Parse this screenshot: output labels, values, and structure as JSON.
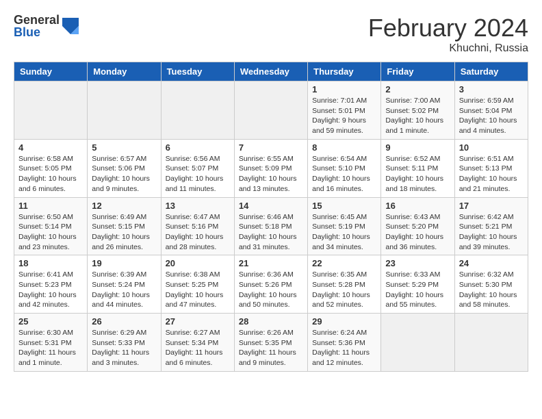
{
  "logo": {
    "general": "General",
    "blue": "Blue"
  },
  "title": "February 2024",
  "location": "Khuchni, Russia",
  "days_of_week": [
    "Sunday",
    "Monday",
    "Tuesday",
    "Wednesday",
    "Thursday",
    "Friday",
    "Saturday"
  ],
  "weeks": [
    [
      {
        "day": "",
        "info": ""
      },
      {
        "day": "",
        "info": ""
      },
      {
        "day": "",
        "info": ""
      },
      {
        "day": "",
        "info": ""
      },
      {
        "day": "1",
        "info": "Sunrise: 7:01 AM\nSunset: 5:01 PM\nDaylight: 9 hours and 59 minutes."
      },
      {
        "day": "2",
        "info": "Sunrise: 7:00 AM\nSunset: 5:02 PM\nDaylight: 10 hours and 1 minute."
      },
      {
        "day": "3",
        "info": "Sunrise: 6:59 AM\nSunset: 5:04 PM\nDaylight: 10 hours and 4 minutes."
      }
    ],
    [
      {
        "day": "4",
        "info": "Sunrise: 6:58 AM\nSunset: 5:05 PM\nDaylight: 10 hours and 6 minutes."
      },
      {
        "day": "5",
        "info": "Sunrise: 6:57 AM\nSunset: 5:06 PM\nDaylight: 10 hours and 9 minutes."
      },
      {
        "day": "6",
        "info": "Sunrise: 6:56 AM\nSunset: 5:07 PM\nDaylight: 10 hours and 11 minutes."
      },
      {
        "day": "7",
        "info": "Sunrise: 6:55 AM\nSunset: 5:09 PM\nDaylight: 10 hours and 13 minutes."
      },
      {
        "day": "8",
        "info": "Sunrise: 6:54 AM\nSunset: 5:10 PM\nDaylight: 10 hours and 16 minutes."
      },
      {
        "day": "9",
        "info": "Sunrise: 6:52 AM\nSunset: 5:11 PM\nDaylight: 10 hours and 18 minutes."
      },
      {
        "day": "10",
        "info": "Sunrise: 6:51 AM\nSunset: 5:13 PM\nDaylight: 10 hours and 21 minutes."
      }
    ],
    [
      {
        "day": "11",
        "info": "Sunrise: 6:50 AM\nSunset: 5:14 PM\nDaylight: 10 hours and 23 minutes."
      },
      {
        "day": "12",
        "info": "Sunrise: 6:49 AM\nSunset: 5:15 PM\nDaylight: 10 hours and 26 minutes."
      },
      {
        "day": "13",
        "info": "Sunrise: 6:47 AM\nSunset: 5:16 PM\nDaylight: 10 hours and 28 minutes."
      },
      {
        "day": "14",
        "info": "Sunrise: 6:46 AM\nSunset: 5:18 PM\nDaylight: 10 hours and 31 minutes."
      },
      {
        "day": "15",
        "info": "Sunrise: 6:45 AM\nSunset: 5:19 PM\nDaylight: 10 hours and 34 minutes."
      },
      {
        "day": "16",
        "info": "Sunrise: 6:43 AM\nSunset: 5:20 PM\nDaylight: 10 hours and 36 minutes."
      },
      {
        "day": "17",
        "info": "Sunrise: 6:42 AM\nSunset: 5:21 PM\nDaylight: 10 hours and 39 minutes."
      }
    ],
    [
      {
        "day": "18",
        "info": "Sunrise: 6:41 AM\nSunset: 5:23 PM\nDaylight: 10 hours and 42 minutes."
      },
      {
        "day": "19",
        "info": "Sunrise: 6:39 AM\nSunset: 5:24 PM\nDaylight: 10 hours and 44 minutes."
      },
      {
        "day": "20",
        "info": "Sunrise: 6:38 AM\nSunset: 5:25 PM\nDaylight: 10 hours and 47 minutes."
      },
      {
        "day": "21",
        "info": "Sunrise: 6:36 AM\nSunset: 5:26 PM\nDaylight: 10 hours and 50 minutes."
      },
      {
        "day": "22",
        "info": "Sunrise: 6:35 AM\nSunset: 5:28 PM\nDaylight: 10 hours and 52 minutes."
      },
      {
        "day": "23",
        "info": "Sunrise: 6:33 AM\nSunset: 5:29 PM\nDaylight: 10 hours and 55 minutes."
      },
      {
        "day": "24",
        "info": "Sunrise: 6:32 AM\nSunset: 5:30 PM\nDaylight: 10 hours and 58 minutes."
      }
    ],
    [
      {
        "day": "25",
        "info": "Sunrise: 6:30 AM\nSunset: 5:31 PM\nDaylight: 11 hours and 1 minute."
      },
      {
        "day": "26",
        "info": "Sunrise: 6:29 AM\nSunset: 5:33 PM\nDaylight: 11 hours and 3 minutes."
      },
      {
        "day": "27",
        "info": "Sunrise: 6:27 AM\nSunset: 5:34 PM\nDaylight: 11 hours and 6 minutes."
      },
      {
        "day": "28",
        "info": "Sunrise: 6:26 AM\nSunset: 5:35 PM\nDaylight: 11 hours and 9 minutes."
      },
      {
        "day": "29",
        "info": "Sunrise: 6:24 AM\nSunset: 5:36 PM\nDaylight: 11 hours and 12 minutes."
      },
      {
        "day": "",
        "info": ""
      },
      {
        "day": "",
        "info": ""
      }
    ]
  ]
}
